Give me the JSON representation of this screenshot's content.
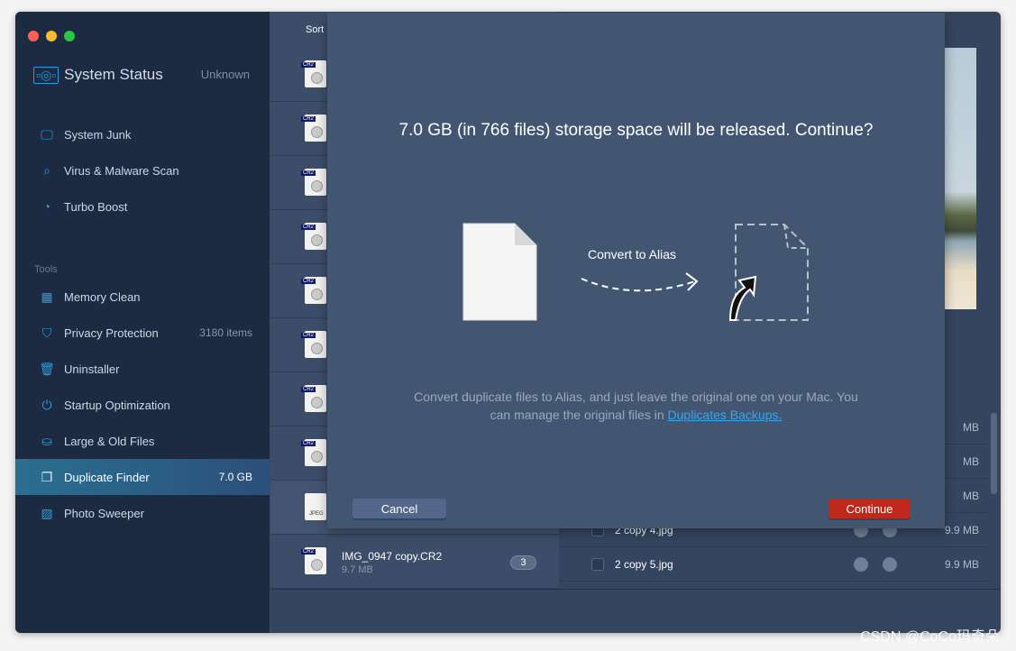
{
  "sidebar": {
    "title": "System Status",
    "status": "Unknown",
    "items": [
      {
        "label": "System Junk",
        "icon": "monitor-icon"
      },
      {
        "label": "Virus & Malware Scan",
        "icon": "laptop-search-icon"
      },
      {
        "label": "Turbo Boost",
        "icon": "speedometer-icon"
      }
    ],
    "tools_label": "Tools",
    "tools": [
      {
        "label": "Memory Clean",
        "icon": "memory-chip-icon",
        "badge": ""
      },
      {
        "label": "Privacy Protection",
        "icon": "shield-icon",
        "badge": "3180 items"
      },
      {
        "label": "Uninstaller",
        "icon": "trash-icon",
        "badge": ""
      },
      {
        "label": "Startup Optimization",
        "icon": "power-icon",
        "badge": ""
      },
      {
        "label": "Large & Old Files",
        "icon": "box-icon",
        "badge": ""
      },
      {
        "label": "Duplicate Finder",
        "icon": "folders-icon",
        "badge": "7.0 GB",
        "active": true
      },
      {
        "label": "Photo Sweeper",
        "icon": "photo-icon",
        "badge": ""
      }
    ]
  },
  "list": {
    "sort_label": "Sort",
    "file_tag": "CR2",
    "jpeg_tag": "JPEG",
    "last": {
      "name": "IMG_0947 copy.CR2",
      "size": "9.7 MB",
      "count": "3"
    }
  },
  "right": {
    "rows": [
      {
        "name": "",
        "size": "MB"
      },
      {
        "name": "",
        "size": "MB"
      },
      {
        "name": "",
        "size": "MB"
      },
      {
        "name": "2 copy 4.jpg",
        "size": "9.9 MB"
      },
      {
        "name": "2 copy 5.jpg",
        "size": "9.9 MB"
      }
    ]
  },
  "modal": {
    "title": "7.0 GB (in 766 files) storage space will be released. Continue?",
    "convert_label": "Convert to Alias",
    "desc": "Convert duplicate files to Alias, and just leave the original one on your Mac. You can manage the original files in ",
    "link": "Duplicates Backups.",
    "cancel": "Cancel",
    "continue": "Continue",
    "accent": "#c0281b"
  },
  "watermark": "CSDN @CoCo玛奇朵"
}
